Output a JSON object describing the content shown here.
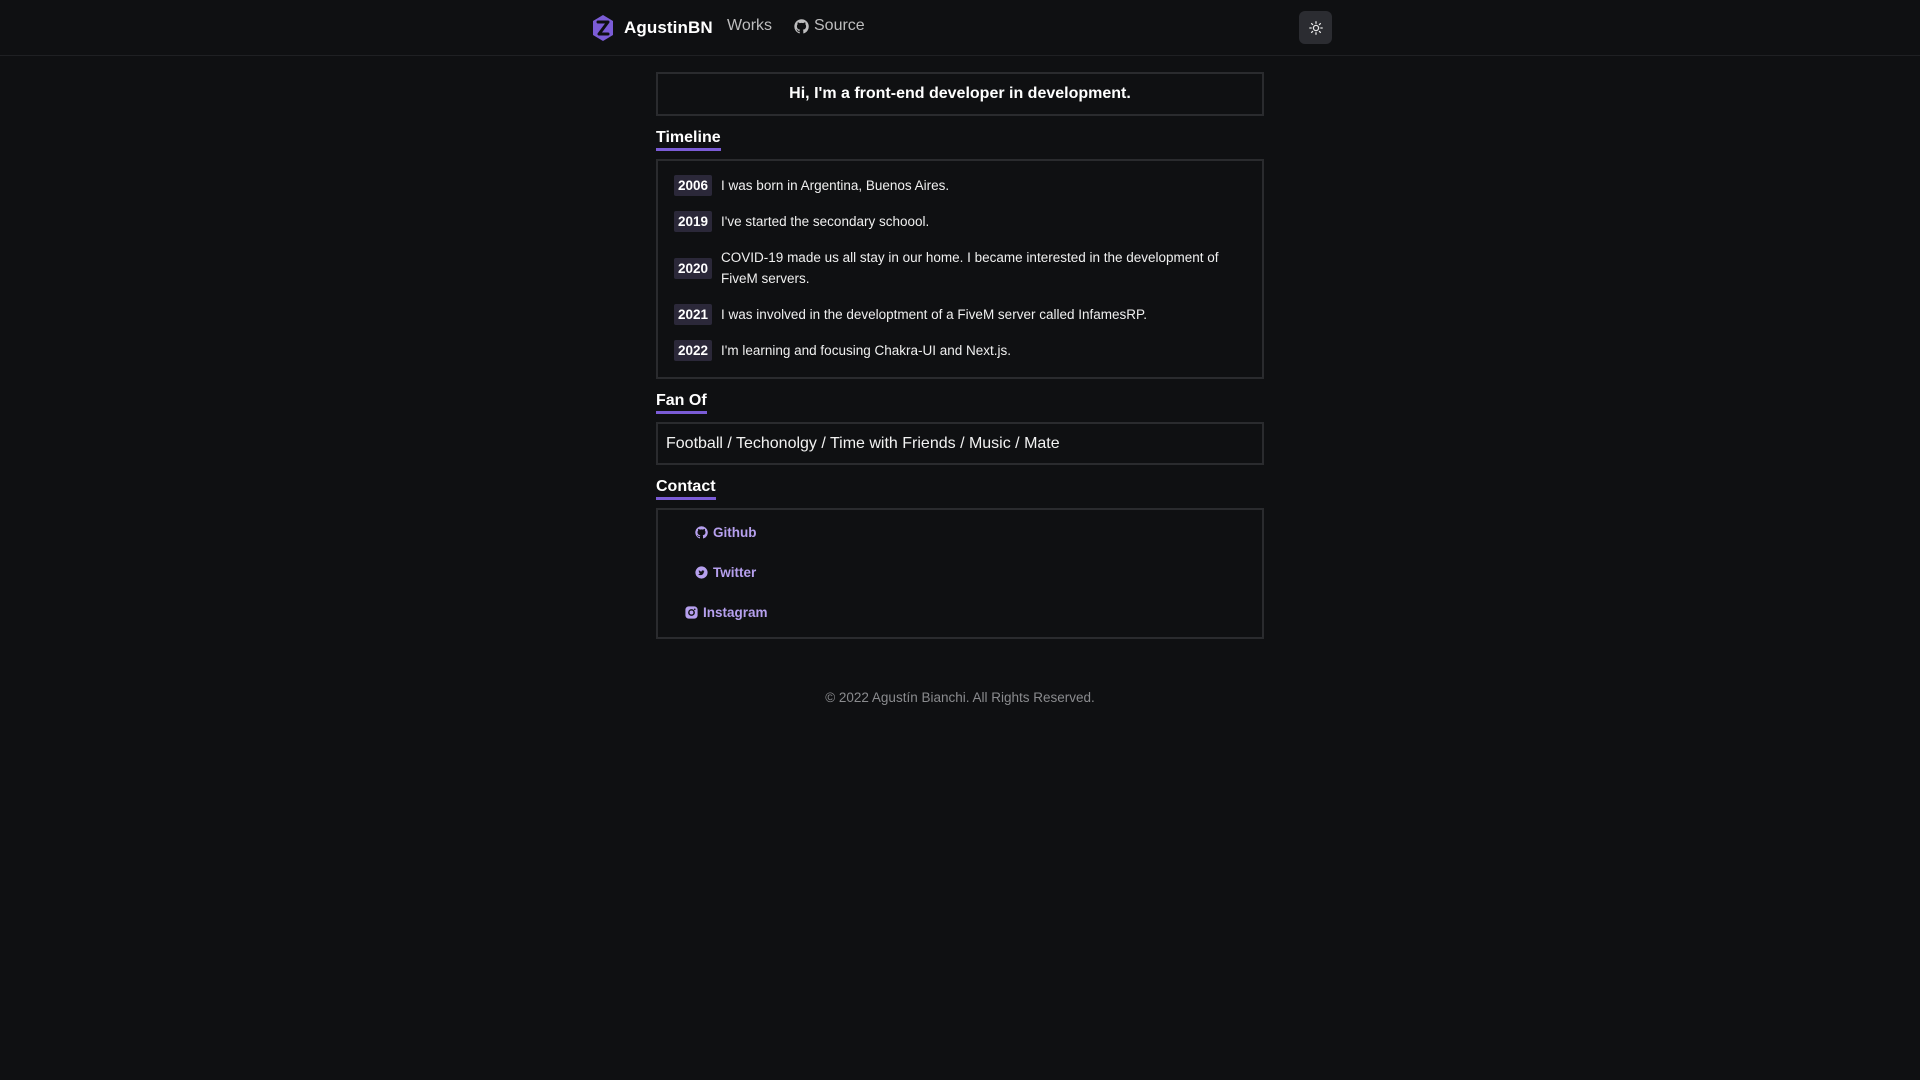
{
  "header": {
    "brand": "AgustinBN",
    "nav": {
      "works": "Works",
      "source": "Source"
    },
    "theme_toggle_icon": "sun-icon"
  },
  "intro": "Hi, I'm a front-end developer in development.",
  "timeline": {
    "title": "Timeline",
    "items": [
      {
        "year": "2006",
        "text": "I was born in Argentina, Buenos Aires."
      },
      {
        "year": "2019",
        "text": "I've started the secondary schoool."
      },
      {
        "year": "2020",
        "text": "COVID-19 made us all stay in our home. I became interested in the development of FiveM servers."
      },
      {
        "year": "2021",
        "text": "I was involved in the developtment of a FiveM server called InfamesRP."
      },
      {
        "year": "2022",
        "text": "I'm learning and focusing Chakra-UI and Next.js."
      }
    ]
  },
  "fan_of": {
    "title": "Fan Of",
    "text": "Football / Techonolgy / Time with Friends / Music / Mate"
  },
  "contact": {
    "title": "Contact",
    "links": [
      {
        "label": "Github",
        "icon": "github-icon"
      },
      {
        "label": "Twitter",
        "icon": "twitter-icon"
      },
      {
        "label": "Instagram",
        "icon": "instagram-icon"
      }
    ]
  },
  "footer": "© 2022 Agustín Bianchi. All Rights Reserved.",
  "colors": {
    "background": "#0f1012",
    "accent": "#7b5cd6",
    "link": "#b6a0ee",
    "year_badge": "#2b2839",
    "border": "#2a2b2e"
  }
}
